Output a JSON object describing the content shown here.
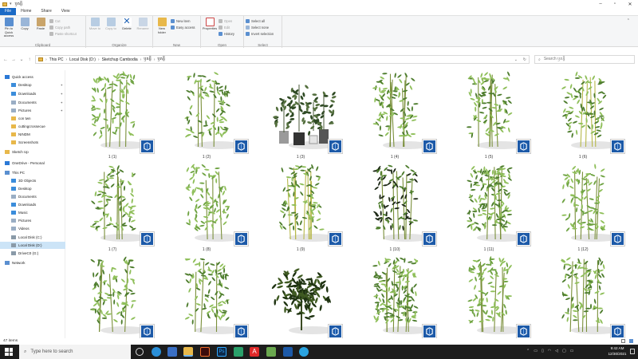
{
  "window": {
    "title": "ឫស្សី"
  },
  "ribbon_tabs": [
    "File",
    "Home",
    "Share",
    "View"
  ],
  "ribbon": {
    "clipboard": {
      "pin": "Pin to Quick access",
      "copy": "Copy",
      "paste": "Paste",
      "cut": "Cut",
      "copy_path": "Copy path",
      "paste_shortcut": "Paste shortcut",
      "name": "Clipboard"
    },
    "organize": {
      "move_to": "Move to",
      "copy_to": "Copy to",
      "delete": "Delete",
      "rename": "Rename",
      "name": "Organize"
    },
    "new": {
      "new_folder": "New folder",
      "new_item": "New item",
      "easy_access": "Easy access",
      "name": "New"
    },
    "open": {
      "properties": "Properties",
      "open": "Open",
      "edit": "Edit",
      "history": "History",
      "name": "Open"
    },
    "select": {
      "select_all": "Select all",
      "select_none": "Select none",
      "invert": "Invert selection",
      "name": "Select"
    }
  },
  "breadcrumb": [
    "This PC",
    "Local Disk (D:)",
    "Sketchup Cambodia",
    "ឫស្សី",
    "ឫស្សី"
  ],
  "search": {
    "placeholder": "Search ឫស្សី"
  },
  "nav": [
    {
      "label": "Quick access",
      "kind": "star"
    },
    {
      "label": "Desktop",
      "kind": "blue",
      "pin": true
    },
    {
      "label": "Downloads",
      "kind": "blue",
      "pin": true
    },
    {
      "label": "Documents",
      "kind": "doc",
      "pin": true
    },
    {
      "label": "Pictures",
      "kind": "doc",
      "pin": true
    },
    {
      "label": "con twn",
      "kind": "folder"
    },
    {
      "label": "cuttingcrossecue",
      "kind": "folder"
    },
    {
      "label": "NINDM",
      "kind": "folder"
    },
    {
      "label": "Screenshots",
      "kind": "folder"
    },
    {
      "label": "Sketch Up",
      "kind": "folder"
    },
    {
      "label": "OneDrive - Personal",
      "kind": "cloud"
    },
    {
      "label": "This PC",
      "kind": "pc"
    },
    {
      "label": "3D Objects",
      "kind": "blue"
    },
    {
      "label": "Desktop",
      "kind": "blue"
    },
    {
      "label": "Documents",
      "kind": "doc"
    },
    {
      "label": "Downloads",
      "kind": "blue"
    },
    {
      "label": "Music",
      "kind": "blue"
    },
    {
      "label": "Pictures",
      "kind": "doc"
    },
    {
      "label": "Videos",
      "kind": "doc"
    },
    {
      "label": "Local Disk (C:)",
      "kind": "drive"
    },
    {
      "label": "Local Disk (D:)",
      "kind": "drive",
      "selected": true
    },
    {
      "label": "DriveC0 (G:)",
      "kind": "drive"
    },
    {
      "label": "Network",
      "kind": "net"
    }
  ],
  "files": [
    {
      "label": "1 (1)"
    },
    {
      "label": "1 (2)"
    },
    {
      "label": "1 (3)"
    },
    {
      "label": "1 (4)"
    },
    {
      "label": "1 (5)"
    },
    {
      "label": "1 (6)"
    },
    {
      "label": "1 (7)"
    },
    {
      "label": "1 (8)"
    },
    {
      "label": "1 (9)"
    },
    {
      "label": "1 (10)"
    },
    {
      "label": "1 (11)"
    },
    {
      "label": "1 (12)"
    },
    {
      "label": ""
    },
    {
      "label": ""
    },
    {
      "label": ""
    },
    {
      "label": ""
    },
    {
      "label": ""
    },
    {
      "label": ""
    }
  ],
  "status": {
    "count": "47 items"
  },
  "taskbar": {
    "search_placeholder": "Type here to search",
    "time": "9:42 AM",
    "date": "12/30/2021"
  },
  "colors": {
    "accent": "#1b6ac6",
    "selected": "#cce4f7",
    "sketchup_tile": "#1d5aa8",
    "taskbar": "#1d1d1d"
  }
}
